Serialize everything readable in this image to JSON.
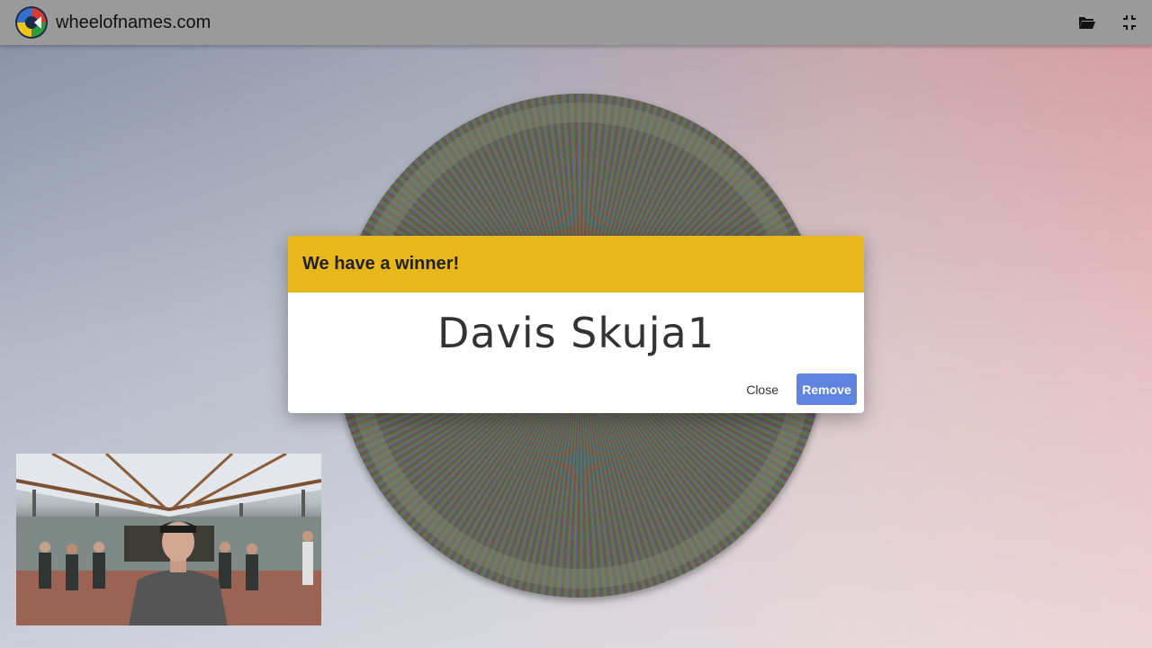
{
  "app": {
    "site_name": "wheelofnames.com"
  },
  "toolbar": {
    "open_icon": "folder-open-icon",
    "fullscreen_icon": "exit-fullscreen-icon"
  },
  "dialog": {
    "title": "We have a winner!",
    "winner_name": "Davis Skuja1",
    "close_label": "Close",
    "remove_label": "Remove"
  },
  "colors": {
    "header_bar": "#9a9a9a",
    "dialog_header": "#e8b71b",
    "remove_button": "#5f84e0"
  }
}
